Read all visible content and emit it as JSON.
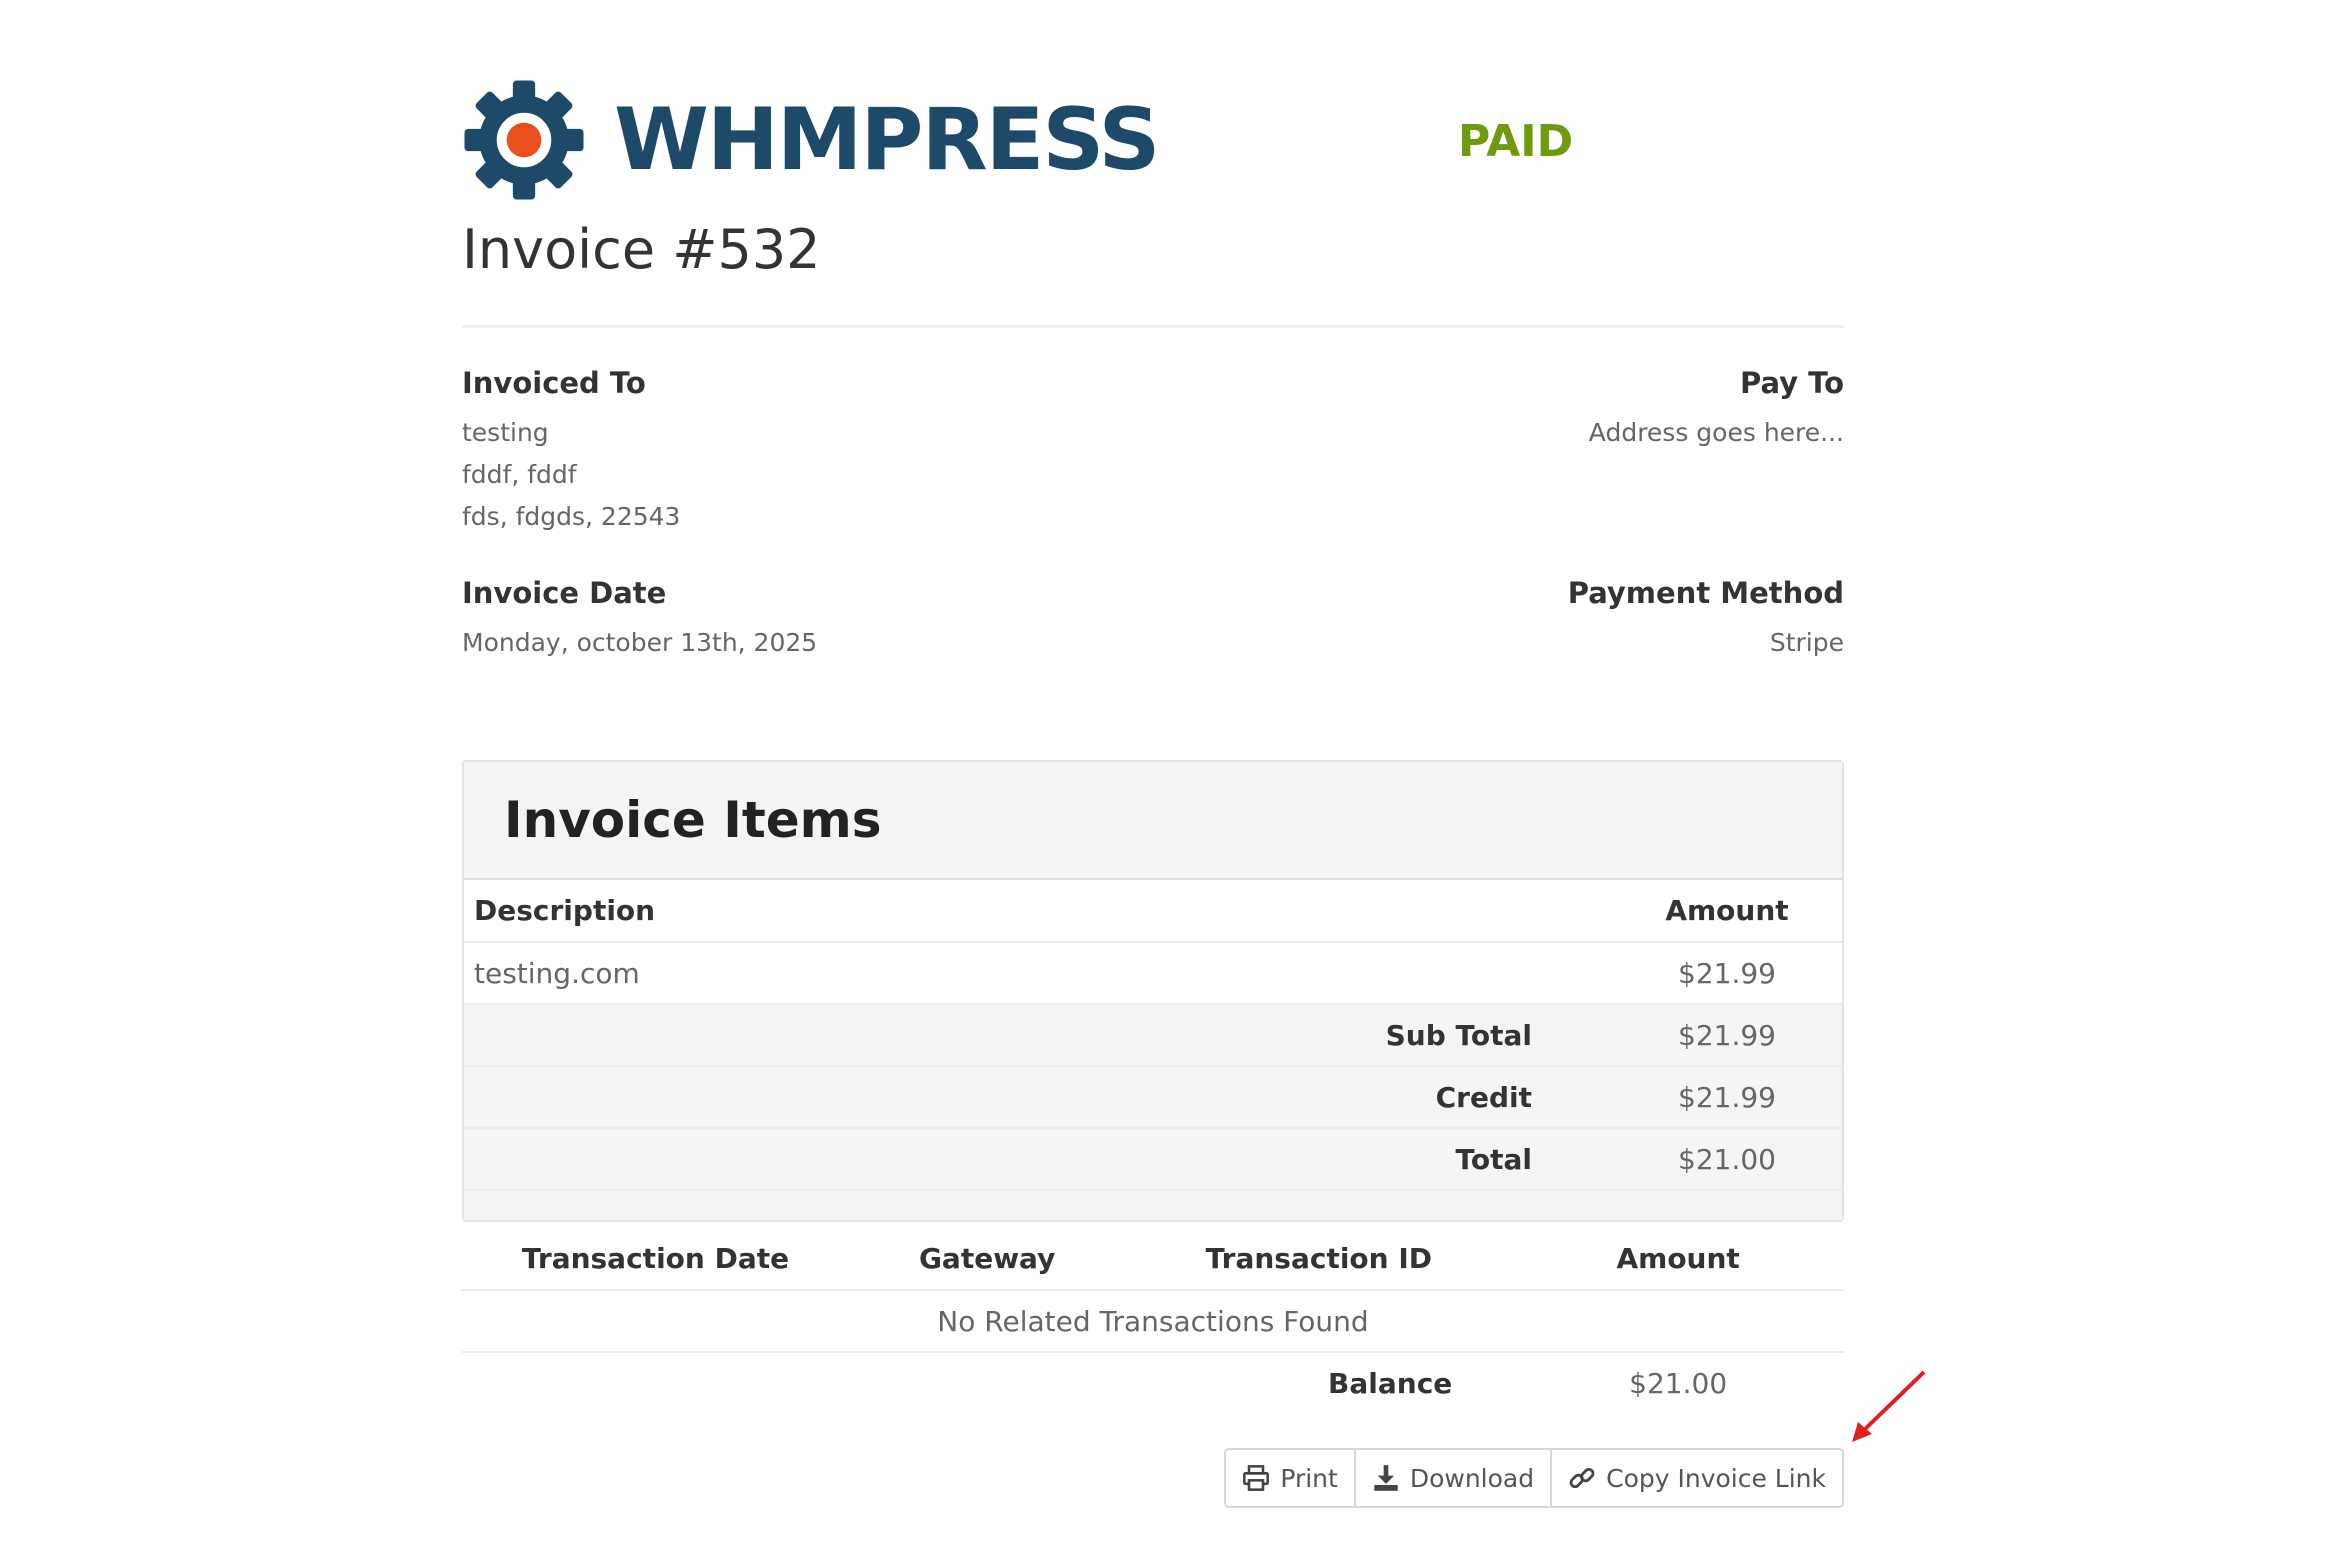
{
  "brand": {
    "name": "WHMPRESS",
    "logo_icon": "gear-icon",
    "colors": {
      "brand": "#1e4a6a",
      "accent": "#e9501e",
      "paid": "#6e9a0e"
    }
  },
  "invoice": {
    "status": "PAID",
    "title": "Invoice #532"
  },
  "invoiced_to": {
    "label": "Invoiced To",
    "lines": [
      "testing",
      "fddf, fddf",
      "fds, fdgds, 22543"
    ]
  },
  "pay_to": {
    "label": "Pay To",
    "lines": [
      "Address goes here..."
    ]
  },
  "invoice_date": {
    "label": "Invoice Date",
    "value": "Monday, october 13th, 2025"
  },
  "payment_method": {
    "label": "Payment Method",
    "value": "Stripe"
  },
  "items": {
    "heading": "Invoice Items",
    "columns": {
      "description": "Description",
      "amount": "Amount"
    },
    "rows": [
      {
        "description": "testing.com",
        "amount": "$21.99"
      }
    ],
    "summary": [
      {
        "label": "Sub Total",
        "amount": "$21.99"
      },
      {
        "label": "Credit",
        "amount": "$21.99"
      },
      {
        "label": "Total",
        "amount": "$21.00"
      }
    ]
  },
  "transactions": {
    "columns": [
      "Transaction Date",
      "Gateway",
      "Transaction ID",
      "Amount"
    ],
    "empty_message": "No Related Transactions Found",
    "balance_label": "Balance",
    "balance_value": "$21.00"
  },
  "actions": {
    "print": {
      "label": "Print",
      "icon": "print-icon"
    },
    "download": {
      "label": "Download",
      "icon": "download-icon"
    },
    "copy_link": {
      "label": "Copy Invoice Link",
      "icon": "link-icon"
    }
  }
}
